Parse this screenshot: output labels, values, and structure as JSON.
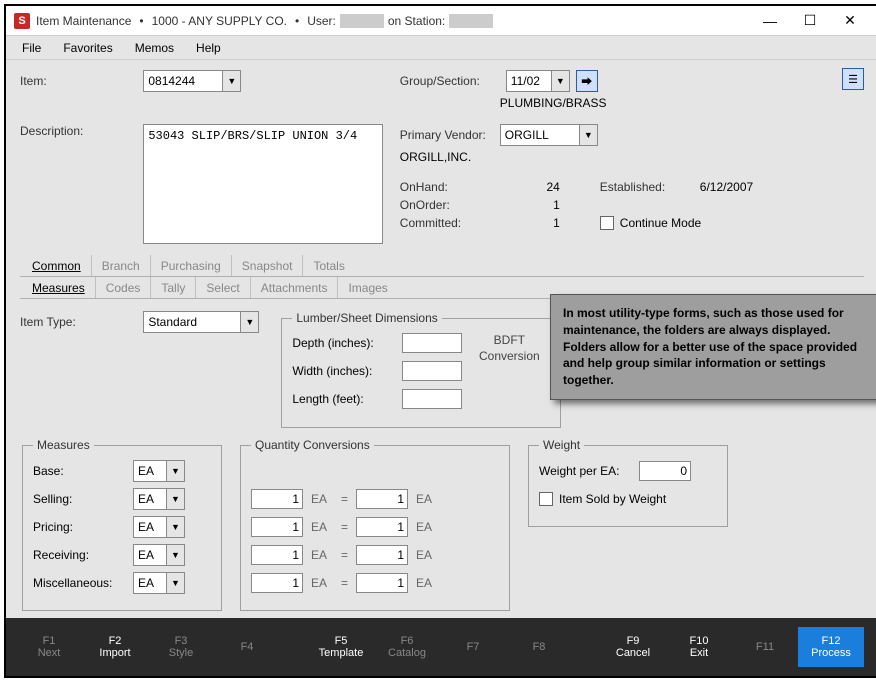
{
  "title": {
    "app": "Item Maintenance",
    "sep": "•",
    "company": "1000 - ANY SUPPLY CO.",
    "user_prefix": "User:",
    "station_prefix": "on Station:"
  },
  "menu": [
    "File",
    "Favorites",
    "Memos",
    "Help"
  ],
  "fields": {
    "item_label": "Item:",
    "item_value": "0814244",
    "description_label": "Description:",
    "description_value": "53043 SLIP/BRS/SLIP UNION 3/4",
    "group_label": "Group/Section:",
    "group_value": "11/02",
    "group_desc": "PLUMBING/BRASS",
    "vendor_label": "Primary Vendor:",
    "vendor_value": "ORGILL",
    "vendor_desc": "ORGILL,INC.",
    "onhand_label": "OnHand:",
    "onhand_value": "24",
    "onorder_label": "OnOrder:",
    "onorder_value": "1",
    "committed_label": "Committed:",
    "committed_value": "1",
    "established_label": "Established:",
    "established_value": "6/12/2007",
    "continue_mode": "Continue Mode"
  },
  "main_tabs": [
    "Common",
    "Branch",
    "Purchasing",
    "Snapshot",
    "Totals"
  ],
  "sub_tabs": [
    "Measures",
    "Codes",
    "Tally",
    "Select",
    "Attachments",
    "Images"
  ],
  "itemtype": {
    "label": "Item Type:",
    "value": "Standard"
  },
  "lumber": {
    "legend": "Lumber/Sheet Dimensions",
    "depth": "Depth (inches):",
    "width": "Width    (inches):",
    "length": "Length (feet):",
    "bdft": "BDFT Conversion"
  },
  "measures": {
    "legend": "Measures",
    "rows": [
      {
        "label": "Base:",
        "value": "EA"
      },
      {
        "label": "Selling:",
        "value": "EA"
      },
      {
        "label": "Pricing:",
        "value": "EA"
      },
      {
        "label": "Receiving:",
        "value": "EA"
      },
      {
        "label": "Miscellaneous:",
        "value": "EA"
      }
    ]
  },
  "qty": {
    "legend": "Quantity Conversions",
    "rows": [
      {
        "lv": "1",
        "lu": "EA",
        "rv": "1",
        "ru": "EA"
      },
      {
        "lv": "1",
        "lu": "EA",
        "rv": "1",
        "ru": "EA"
      },
      {
        "lv": "1",
        "lu": "EA",
        "rv": "1",
        "ru": "EA"
      },
      {
        "lv": "1",
        "lu": "EA",
        "rv": "1",
        "ru": "EA"
      }
    ]
  },
  "weight": {
    "legend": "Weight",
    "label": "Weight per EA:",
    "value": "0",
    "sold_label": "Item Sold by Weight"
  },
  "tooltip": "In most utility-type forms, such as those used for maintenance, the folders are always displayed. Folders allow for a better use of the space provided and help group similar information or settings together.",
  "fkeys": [
    {
      "k": "F1",
      "l": "Next",
      "cls": ""
    },
    {
      "k": "F2",
      "l": "Import",
      "cls": "active"
    },
    {
      "k": "F3",
      "l": "Style",
      "cls": ""
    },
    {
      "k": "F4",
      "l": "",
      "cls": ""
    },
    {
      "k": "",
      "l": "",
      "cls": "gap"
    },
    {
      "k": "F5",
      "l": "Template",
      "cls": "active"
    },
    {
      "k": "F6",
      "l": "Catalog",
      "cls": ""
    },
    {
      "k": "F7",
      "l": "",
      "cls": ""
    },
    {
      "k": "F8",
      "l": "",
      "cls": ""
    },
    {
      "k": "",
      "l": "",
      "cls": "gap"
    },
    {
      "k": "F9",
      "l": "Cancel",
      "cls": "active"
    },
    {
      "k": "F10",
      "l": "Exit",
      "cls": "active"
    },
    {
      "k": "F11",
      "l": "",
      "cls": ""
    },
    {
      "k": "F12",
      "l": "Process",
      "cls": "primary"
    }
  ]
}
